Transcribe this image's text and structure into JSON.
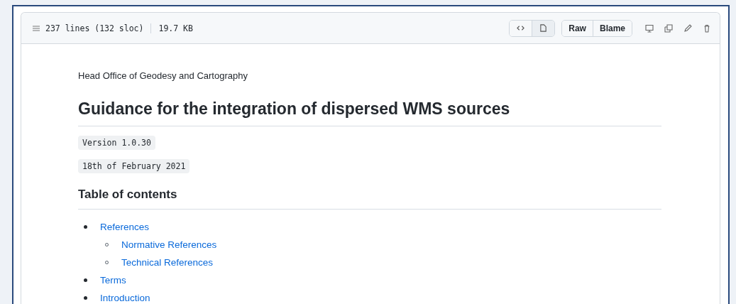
{
  "file_header": {
    "summary": "237 lines (132 sloc)",
    "size": "19.7 KB",
    "view_toggle": [
      {
        "kind": "code",
        "selected": false
      },
      {
        "kind": "preview",
        "selected": true
      }
    ],
    "buttons": [
      "Raw",
      "Blame"
    ],
    "actions": [
      {
        "kind": "display"
      },
      {
        "kind": "copy"
      },
      {
        "kind": "edit"
      },
      {
        "kind": "delete"
      }
    ]
  },
  "document": {
    "organization": "Head Office of Geodesy and Cartography",
    "title": "Guidance for the integration of dispersed WMS sources",
    "code_lines": [
      "Version 1.0.30",
      "18th of February 2021"
    ],
    "toc_heading": "Table of contents",
    "toc": [
      {
        "label": "References",
        "children": [
          {
            "label": "Normative References"
          },
          {
            "label": "Technical References"
          }
        ]
      },
      {
        "label": "Terms"
      },
      {
        "label": "Introduction"
      }
    ]
  }
}
